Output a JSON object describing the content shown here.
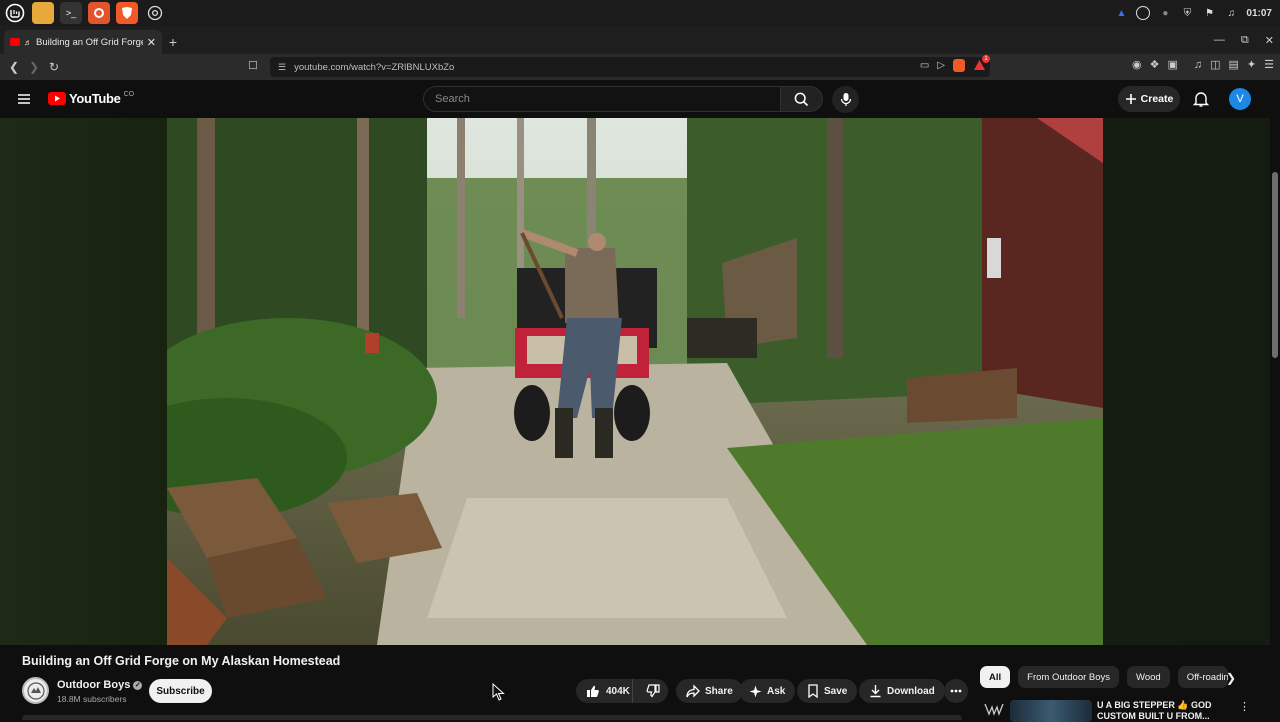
{
  "os": {
    "clock": "01:07"
  },
  "browser": {
    "tab_title": "Building an Off Grid Forge",
    "new_tab_symbol": "+",
    "url": "youtube.com/watch?v=ZRlBNLUXbZo",
    "ext_badge_count": "1"
  },
  "youtube": {
    "logo_text": "YouTube",
    "logo_sup": "CO",
    "search_placeholder": "Search",
    "create_label": "Create",
    "avatar_letter": "V"
  },
  "video": {
    "title": "Building an Off Grid Forge on My Alaskan Homestead",
    "channel_name": "Outdoor Boys",
    "subscribers": "18.8M subscribers",
    "subscribe_label": "Subscribe",
    "likes": "404K",
    "actions": {
      "share": "Share",
      "ask": "Ask",
      "save": "Save",
      "download": "Download"
    }
  },
  "sidebar": {
    "chips": [
      "All",
      "From Outdoor Boys",
      "Wood",
      "Off-roading"
    ],
    "recommendation": {
      "title": "U A BIG STEPPER 👍 GOD CUSTOM BUILT U FROM..."
    }
  },
  "colors": {
    "youtube_red": "#ff0000",
    "background": "#0f0f0f",
    "pill": "#272727",
    "avatar_blue": "#1c88e5"
  }
}
